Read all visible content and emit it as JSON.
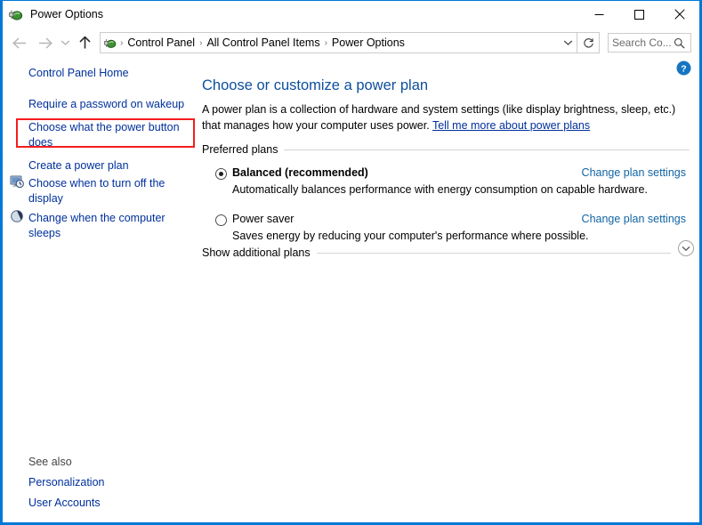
{
  "window": {
    "title": "Power Options",
    "app_icon": "power-plug-battery-icon",
    "controls": {
      "minimize": "Minimize",
      "maximize": "Maximize",
      "close": "Close"
    }
  },
  "navbar": {
    "back": "Back",
    "forward": "Forward",
    "recent": "Recent locations",
    "up": "Up one level",
    "breadcrumb": {
      "icon": "power-plug-battery-icon",
      "items": [
        "Control Panel",
        "All Control Panel Items",
        "Power Options"
      ],
      "separator": "›"
    },
    "dropdown": "Previous locations",
    "refresh": "Refresh",
    "search": {
      "placeholder": "Search Co...",
      "value": "",
      "icon": "search-icon"
    }
  },
  "sidebar": {
    "items": [
      {
        "label": "Control Panel Home",
        "icon": null
      },
      {
        "label": "Require a password on wakeup",
        "icon": null
      },
      {
        "label": "Choose what the power button does",
        "icon": null,
        "highlighted": true
      },
      {
        "label": "Create a power plan",
        "icon": null
      },
      {
        "label": "Choose when to turn off the display",
        "icon": "display-clock-icon"
      },
      {
        "label": "Change when the computer sleeps",
        "icon": "moon-sleep-icon"
      }
    ],
    "see_also": {
      "label": "See also",
      "items": [
        "Personalization",
        "User Accounts"
      ]
    }
  },
  "main": {
    "help_icon": "help-question-icon",
    "heading": "Choose or customize a power plan",
    "description_before": "A power plan is a collection of hardware and system settings (like display brightness, sleep, etc.) that manages how your computer uses power. ",
    "description_link": "Tell me more about power plans",
    "preferred_plans_label": "Preferred plans",
    "plans": [
      {
        "name": "Balanced (recommended)",
        "selected": true,
        "description": "Automatically balances performance with energy consumption on capable hardware.",
        "action": "Change plan settings"
      },
      {
        "name": "Power saver",
        "selected": false,
        "description": "Saves energy by reducing your computer's performance where possible.",
        "action": "Change plan settings"
      }
    ],
    "additional_plans_label": "Show additional plans",
    "expander_icon": "chevron-down-icon"
  },
  "colors": {
    "window_border": "#0078d7",
    "heading": "#0c4f9c",
    "link": "#00309c",
    "action_link": "#1264a3",
    "highlight": "#f41d1d",
    "help_blue": "#1675c1"
  }
}
